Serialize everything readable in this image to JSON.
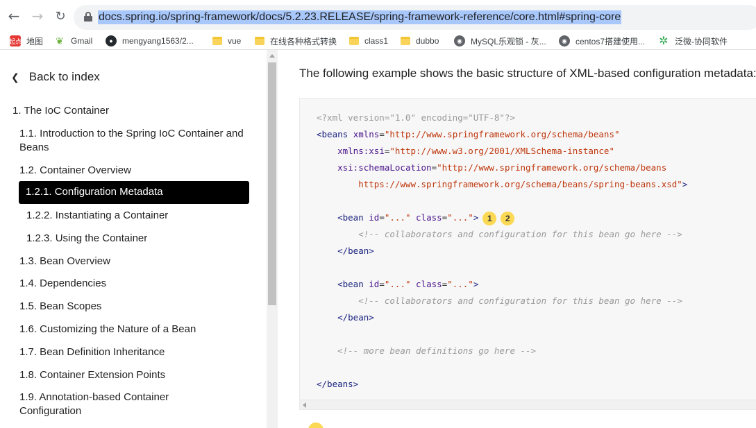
{
  "browser": {
    "url": "docs.spring.io/spring-framework/docs/5.2.23.RELEASE/spring-framework-reference/core.html#spring-core",
    "back_glyph": "←",
    "forward_glyph": "→",
    "reload_glyph": "↻"
  },
  "bookmarks": [
    {
      "label": "地图",
      "icon": "map-icon",
      "icon_text": "起点"
    },
    {
      "label": "Gmail",
      "icon": "spring-leaf-icon",
      "icon_text": "❦"
    },
    {
      "label": "mengyang1563/2...",
      "icon": "github-icon",
      "icon_text": "●"
    },
    {
      "label": "vue",
      "icon": "folder-icon",
      "icon_text": ""
    },
    {
      "label": "在线各种格式转换",
      "icon": "folder-icon",
      "icon_text": ""
    },
    {
      "label": "class1",
      "icon": "folder-icon",
      "icon_text": ""
    },
    {
      "label": "dubbo",
      "icon": "folder-icon",
      "icon_text": ""
    },
    {
      "label": "MySQL乐观锁 - 灰...",
      "icon": "globe-icon",
      "icon_text": "◉"
    },
    {
      "label": "centos7搭建使用...",
      "icon": "globe-icon",
      "icon_text": "◉"
    },
    {
      "label": "泛微-协同软件",
      "icon": "gear-icon",
      "icon_text": "✲"
    }
  ],
  "sidebar": {
    "back_label": "Back to index",
    "items": [
      {
        "label": "1. The IoC Container"
      },
      {
        "label": "1.1. Introduction to the Spring IoC Container and Beans"
      },
      {
        "label": "1.2. Container Overview"
      },
      {
        "label": "1.2.1. Configuration Metadata",
        "active": true
      },
      {
        "label": "1.2.2. Instantiating a Container"
      },
      {
        "label": "1.2.3. Using the Container"
      },
      {
        "label": "1.3. Bean Overview"
      },
      {
        "label": "1.4. Dependencies"
      },
      {
        "label": "1.5. Bean Scopes"
      },
      {
        "label": "1.6. Customizing the Nature of a Bean"
      },
      {
        "label": "1.7. Bean Definition Inheritance"
      },
      {
        "label": "1.8. Container Extension Points"
      },
      {
        "label": "1.9. Annotation-based Container Configuration"
      }
    ]
  },
  "content": {
    "lead": "The following example shows the basic structure of XML-based configuration metadata:",
    "callouts": [
      "1",
      "2"
    ]
  }
}
